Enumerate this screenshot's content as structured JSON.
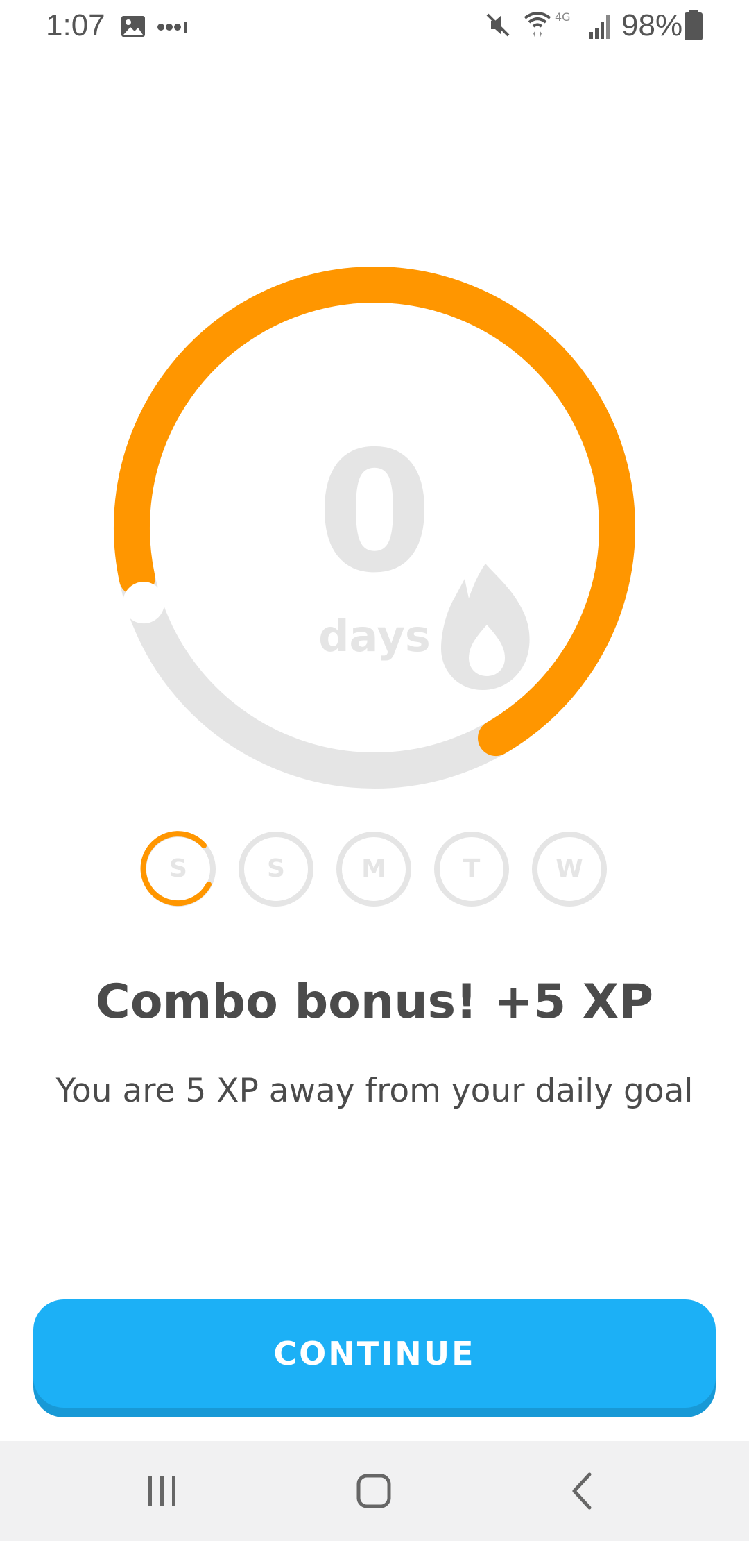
{
  "status_bar": {
    "time": "1:07",
    "battery": "98%",
    "icons": [
      "image-icon",
      "more-dots-icon",
      "mute-icon",
      "wifi-icon",
      "lte-signal-icon",
      "battery-icon"
    ]
  },
  "streak": {
    "count": "0",
    "unit": "days",
    "progress_fraction": 0.7,
    "colors": {
      "progress": "#ff9600",
      "track": "#e5e5e5"
    }
  },
  "week": {
    "days": [
      {
        "letter": "S",
        "state": "in-progress"
      },
      {
        "letter": "S",
        "state": "empty"
      },
      {
        "letter": "M",
        "state": "empty"
      },
      {
        "letter": "T",
        "state": "empty"
      },
      {
        "letter": "W",
        "state": "empty"
      }
    ]
  },
  "message": {
    "headline": "Combo bonus! +5 XP",
    "subtext": "You are 5 XP away from your daily goal"
  },
  "continue_button": {
    "label": "CONTINUE",
    "color": "#1cb0f6"
  },
  "nav_bar": {
    "icons": [
      "recent-apps-icon",
      "home-icon",
      "back-icon"
    ]
  }
}
